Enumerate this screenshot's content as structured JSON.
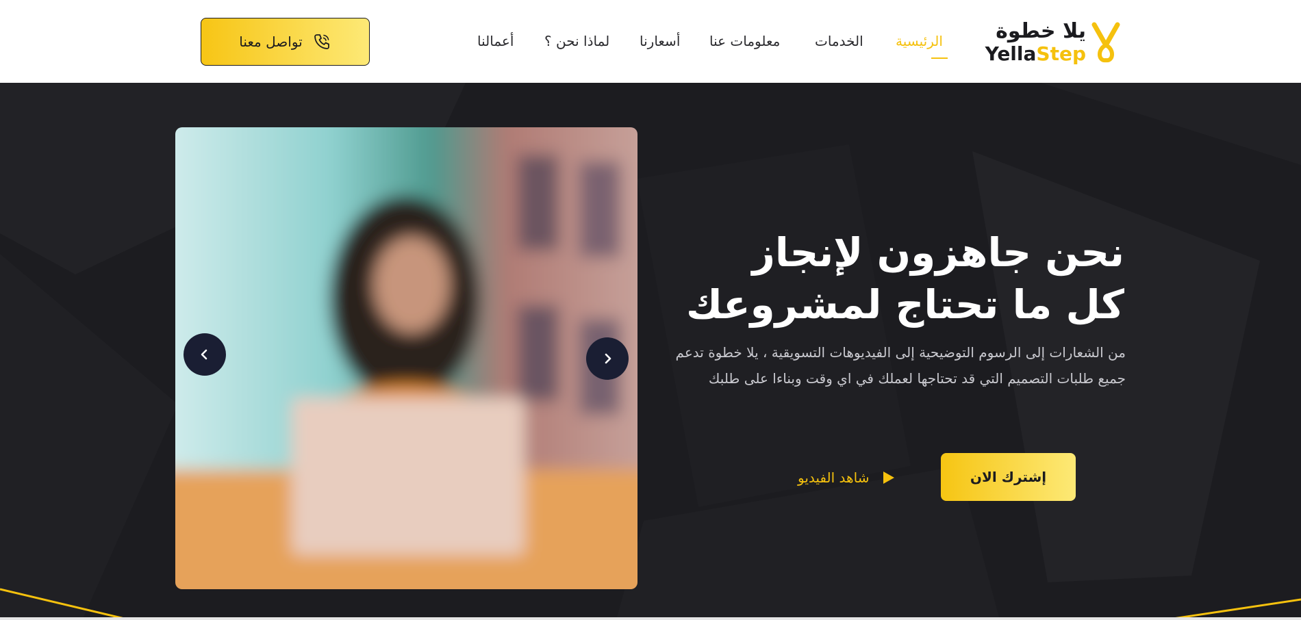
{
  "header": {
    "logo": {
      "arabic": "يلا خطوة",
      "latin_prefix": "Yella",
      "latin_suffix": "Step"
    },
    "nav": [
      {
        "label": "الرئيسية",
        "active": true
      },
      {
        "label": "الخدمات",
        "active": false
      },
      {
        "label": "معلومات عنا",
        "active": false
      },
      {
        "label": "أسعارنا",
        "active": false
      },
      {
        "label": "لماذا نحن ؟",
        "active": false
      },
      {
        "label": "أعمالنا",
        "active": false
      }
    ],
    "contact_button": {
      "label": "تواصل معنا",
      "icon": "phone-icon"
    }
  },
  "hero": {
    "title_line1": "نحن جاهزون لإنجاز",
    "title_line2": "كل ما تحتاج لمشروعك",
    "description": "من الشعارات إلى الرسوم التوضيحية إلى الفيديوهات التسويقية ، يلا خطوة تدعم جميع طلبات التصميم التي قد تحتاجها لعملك في اي وقت وبناءا على طلبك",
    "subscribe_button": "إشترك الان",
    "watch_video": {
      "label": "شاهد الفيديو",
      "icon": "play-icon"
    },
    "slider": {
      "prev_icon": "chevron-left-icon",
      "next_icon": "chevron-right-icon"
    }
  },
  "colors": {
    "accent": "#f5c10e",
    "accent_light": "#fde976",
    "hero_bg": "#1c1c20",
    "arrow_bg": "#1a1e33",
    "text_dark": "#1b1b1f"
  }
}
